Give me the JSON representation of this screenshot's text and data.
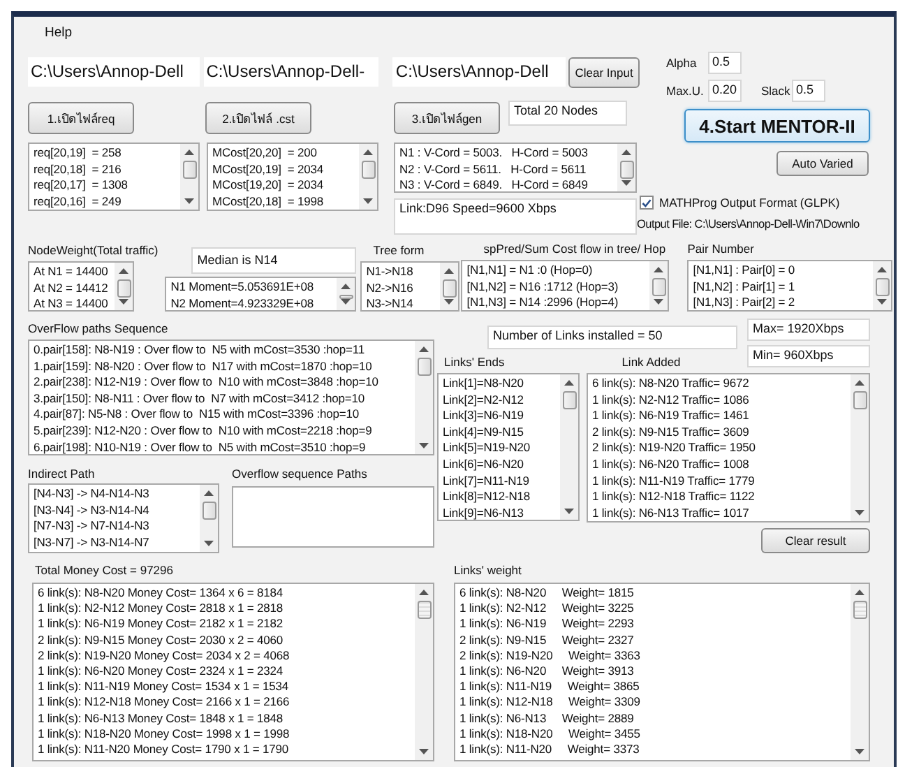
{
  "menu": [
    {
      "label": "Help"
    }
  ],
  "path_fields": [
    "C:\\Users\\Annop-Dell",
    "C:\\Users\\Annop-Dell-",
    "C:\\Users\\Annop-Dell"
  ],
  "clear_input_button": "Clear Input",
  "open_buttons": [
    "1.เปิดไฟล์req",
    "2.เปิดไฟล์ .cst",
    "3.เปิดไฟล์gen"
  ],
  "total_nodes": "Total 20 Nodes",
  "req_list": [
    "req[20,19]  = 258",
    "req[20,18]  = 216",
    "req[20,17]  = 1308",
    "req[20,16]  = 249"
  ],
  "mcost_list": [
    "MCost[20,20]  = 200",
    "MCost[20,19]  = 2034",
    "MCost[19,20]  = 2034",
    "MCost[20,18]  = 1998"
  ],
  "coord_list": [
    "N1 : V-Cord = 5003.   H-Cord = 5003",
    "N2 : V-Cord = 5611.   H-Cord = 5611",
    "N3 : V-Cord = 6849.   H-Cord = 6849"
  ],
  "link_info": "Link:D96  Speed=9600 Xbps",
  "params": [
    {
      "label": "Alpha",
      "value": "0.5"
    },
    {
      "label": "Max.U.",
      "value": "0.20"
    },
    {
      "label": "Slack",
      "value": "0.5"
    }
  ],
  "start_button": "4.Start MENTOR-II",
  "auto_varied_button": "Auto Varied",
  "mathprog": {
    "label": "MATHProg Output Format (GLPK)",
    "checked": true
  },
  "output_file": "Output File: C:\\Users\\Annop-Dell-Win7\\Downlo",
  "node_weight": {
    "label": "NodeWeight(Total traffic)",
    "items": [
      "At N1 = 14400",
      "At N2 = 14412",
      "At N3 = 14400"
    ]
  },
  "median": "Median is N14",
  "moments": [
    "N1 Moment=5.053691E+08",
    "N2 Moment=4.923329E+08"
  ],
  "tree_form": {
    "label": "Tree form",
    "items": [
      "N1->N18",
      "N2->N16",
      "N3->N14"
    ]
  },
  "sp_pred": {
    "label": "spPred/Sum Cost flow in tree/ Hop",
    "items": [
      "[N1,N1] = N1 :0 (Hop=0)",
      "[N1,N2] = N16 :1712 (Hop=3)",
      "[N1,N3] = N14 :2996 (Hop=4)"
    ]
  },
  "pair_number": {
    "label": "Pair Number",
    "items": [
      "[N1,N1] : Pair[0] = 0",
      "[N1,N2] : Pair[1] = 1",
      "[N1,N3] : Pair[2] = 2"
    ]
  },
  "overflow_paths": {
    "label": "OverFlow paths Sequence",
    "items": [
      "0.pair[158]: N8-N19 : Over flow to  N5 with mCost=3530 :hop=11",
      "1.pair[159]: N8-N20 : Over flow to  N17 with mCost=1870 :hop=10",
      "2.pair[238]: N12-N19 : Over flow to  N10 with mCost=3848 :hop=10",
      "3.pair[150]: N8-N11 : Over flow to  N7 with mCost=3412 :hop=10",
      "4.pair[87]: N5-N8 : Over flow to  N15 with mCost=3396 :hop=10",
      "5.pair[239]: N12-N20 : Over flow to  N10 with mCost=2218 :hop=9",
      "6.pair[198]: N10-N19 : Over flow to  N5 with mCost=3510 :hop=9"
    ]
  },
  "links_installed": "Number of Links installed = 50",
  "max_speed": "Max= 1920Xbps",
  "min_speed": "Min= 960Xbps",
  "links_ends": {
    "label": "Links' Ends",
    "items": [
      "Link[1]=N8-N20",
      "Link[2]=N2-N12",
      "Link[3]=N6-N19",
      "Link[4]=N9-N15",
      "Link[5]=N19-N20",
      "Link[6]=N6-N20",
      "Link[7]=N11-N19",
      "Link[8]=N12-N18",
      "Link[9]=N6-N13"
    ]
  },
  "link_added": {
    "label": "Link Added",
    "items": [
      "6 link(s): N8-N20 Traffic= 9672",
      "1 link(s): N2-N12 Traffic= 1086",
      "1 link(s): N6-N19 Traffic= 1461",
      "2 link(s): N9-N15 Traffic= 3609",
      "2 link(s): N19-N20 Traffic= 1950",
      "1 link(s): N6-N20 Traffic= 1008",
      "1 link(s): N11-N19 Traffic= 1779",
      "1 link(s): N12-N18 Traffic= 1122",
      "1 link(s): N6-N13 Traffic= 1017"
    ]
  },
  "clear_result_button": "Clear result",
  "indirect_path": {
    "label": "Indirect Path",
    "items": [
      "[N4-N3] -> N4-N14-N3",
      "[N3-N4] -> N3-N14-N4",
      "[N7-N3] -> N7-N14-N3",
      "[N3-N7] -> N3-N14-N7"
    ]
  },
  "overflow_sequence": {
    "label": "Overflow sequence Paths"
  },
  "money": {
    "label": "Total Money Cost = 97296",
    "items": [
      "6 link(s): N8-N20 Money Cost= 1364 x 6 = 8184",
      "1 link(s): N2-N12 Money Cost= 2818 x 1 = 2818",
      "1 link(s): N6-N19 Money Cost= 2182 x 1 = 2182",
      "2 link(s): N9-N15 Money Cost= 2030 x 2 = 4060",
      "2 link(s): N19-N20 Money Cost= 2034 x 2 = 4068",
      "1 link(s): N6-N20 Money Cost= 2324 x 1 = 2324",
      "1 link(s): N11-N19 Money Cost= 1534 x 1 = 1534",
      "1 link(s): N12-N18 Money Cost= 2166 x 1 = 2166",
      "1 link(s): N6-N13 Money Cost= 1848 x 1 = 1848",
      "1 link(s): N18-N20 Money Cost= 1998 x 1 = 1998",
      "1 link(s): N11-N20 Money Cost= 1790 x 1 = 1790"
    ]
  },
  "links_weight": {
    "label": "Links' weight",
    "items": [
      "6 link(s): N8-N20     Weight= 1815",
      "1 link(s): N2-N12     Weight= 3225",
      "1 link(s): N6-N19     Weight= 2293",
      "2 link(s): N9-N15     Weight= 2327",
      "2 link(s): N19-N20     Weight= 3363",
      "1 link(s): N6-N20     Weight= 3913",
      "1 link(s): N11-N19     Weight= 3865",
      "1 link(s): N12-N18     Weight= 3309",
      "1 link(s): N6-N13     Weight= 2889",
      "1 link(s): N18-N20     Weight= 3455",
      "1 link(s): N11-N20     Weight= 3373"
    ]
  }
}
